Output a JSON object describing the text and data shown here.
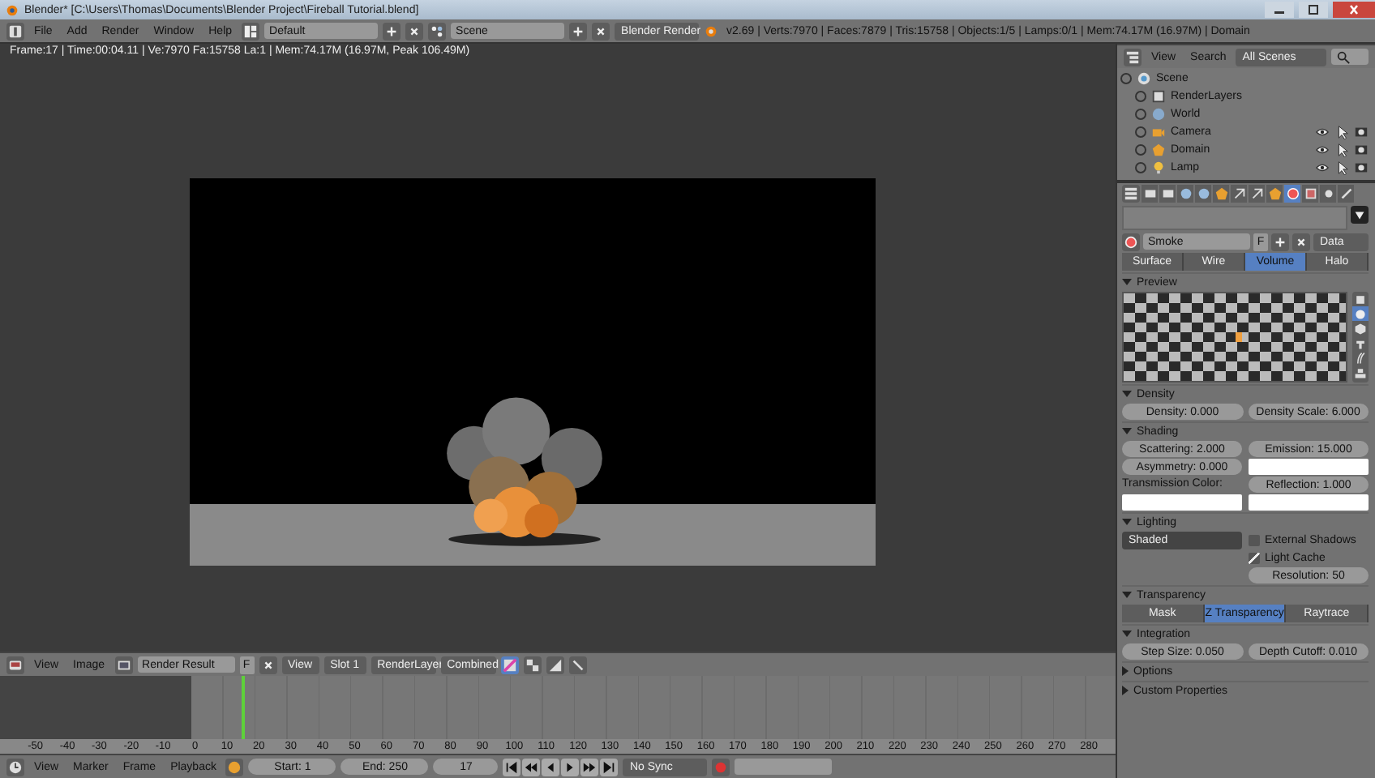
{
  "window": {
    "title": "Blender* [C:\\Users\\Thomas\\Documents\\Blender Project\\Fireball Tutorial.blend]"
  },
  "menu": [
    "File",
    "Add",
    "Render",
    "Window",
    "Help"
  ],
  "layout": "Default",
  "scene": "Scene",
  "engine": "Blender Render",
  "stats": "v2.69 | Verts:7970 | Faces:7879 | Tris:15758 | Objects:1/5 | Lamps:0/1 | Mem:74.17M (16.97M) | Domain",
  "image_editor": {
    "info": "Frame:17 | Time:00:04.11 | Ve:7970 Fa:15758 La:1 | Mem:74.17M (16.97M, Peak 106.49M)",
    "menus": [
      "View",
      "Image"
    ],
    "image": "Render Result",
    "fake_user": "F",
    "view": "View",
    "slot": "Slot 1",
    "layer": "RenderLayer",
    "pass": "Combined"
  },
  "timeline": {
    "playhead": {
      "level": 0.217
    },
    "ruler": [
      "-50",
      "-40",
      "-30",
      "-20",
      "-10",
      "0",
      "10",
      "20",
      "30",
      "40",
      "50",
      "60",
      "70",
      "80",
      "90",
      "100",
      "110",
      "120",
      "130",
      "140",
      "150",
      "160",
      "170",
      "180",
      "190",
      "200",
      "210",
      "220",
      "230",
      "240",
      "250",
      "260",
      "270",
      "280"
    ],
    "menus": [
      "View",
      "Marker",
      "Frame",
      "Playback"
    ],
    "start": "Start: 1",
    "end": "End: 250",
    "current": "17",
    "sync": "No Sync"
  },
  "outliner": {
    "menus": [
      "View",
      "Search"
    ],
    "filter": "All Scenes",
    "tree": [
      {
        "label": "Scene",
        "kind": "scene",
        "children": [
          {
            "label": "RenderLayers",
            "kind": "layers"
          },
          {
            "label": "World",
            "kind": "world"
          },
          {
            "label": "Camera",
            "kind": "camera"
          },
          {
            "label": "Domain",
            "kind": "mesh"
          },
          {
            "label": "Lamp",
            "kind": "lamp"
          }
        ]
      }
    ]
  },
  "properties": {
    "tabs": [
      {
        "kind": "render",
        "selected": false
      },
      {
        "kind": "layers",
        "selected": false
      },
      {
        "kind": "scene",
        "selected": false
      },
      {
        "kind": "world",
        "selected": false
      },
      {
        "kind": "object",
        "selected": false
      },
      {
        "kind": "constraints",
        "selected": false
      },
      {
        "kind": "modifiers",
        "selected": false
      },
      {
        "kind": "data",
        "selected": false
      },
      {
        "kind": "material",
        "selected": true
      },
      {
        "kind": "texture",
        "selected": false
      },
      {
        "kind": "particles",
        "selected": false
      },
      {
        "kind": "physics",
        "selected": false
      }
    ],
    "material": "Smoke",
    "fake_user": "F",
    "link": "Data",
    "types": [
      {
        "label": "Surface",
        "selected": false
      },
      {
        "label": "Wire",
        "selected": false
      },
      {
        "label": "Volume",
        "selected": true
      },
      {
        "label": "Halo",
        "selected": false
      }
    ],
    "preview": {
      "title": "Preview",
      "expanded": true,
      "shapes": [
        {
          "kind": "flat",
          "selected": false
        },
        {
          "kind": "sphere",
          "selected": true
        },
        {
          "kind": "cube",
          "selected": false
        },
        {
          "kind": "monkey",
          "selected": false
        },
        {
          "kind": "hair",
          "selected": false
        },
        {
          "kind": "sky",
          "selected": false
        }
      ]
    },
    "density": {
      "title": "Density",
      "expanded": true,
      "fields": [
        "Density: 0.000",
        "Density Scale: 6.000"
      ]
    },
    "shading": {
      "title": "Shading",
      "expanded": true,
      "scattering": "Scattering: 2.000",
      "asymmetry": "Asymmetry: 0.000",
      "emission": "Emission: 15.000",
      "transmission_label": "Transmission Color:",
      "reflection": "Reflection: 1.000"
    },
    "lighting": {
      "title": "Lighting",
      "expanded": true,
      "mode": "Shaded",
      "external_shadows": {
        "label": "External Shadows",
        "checked": false
      },
      "light_cache": {
        "label": "Light Cache",
        "checked": true
      },
      "resolution": "Resolution: 50"
    },
    "transparency": {
      "title": "Transparency",
      "expanded": true,
      "modes": [
        {
          "label": "Mask",
          "selected": false
        },
        {
          "label": "Z Transparency",
          "selected": true
        },
        {
          "label": "Raytrace",
          "selected": false
        }
      ]
    },
    "integration": {
      "title": "Integration",
      "expanded": true,
      "fields": [
        "Step Size: 0.050",
        "Depth Cutoff: 0.010"
      ]
    },
    "collapsed": [
      {
        "title": "Options",
        "expanded": false
      },
      {
        "title": "Custom Properties",
        "expanded": false
      }
    ]
  }
}
